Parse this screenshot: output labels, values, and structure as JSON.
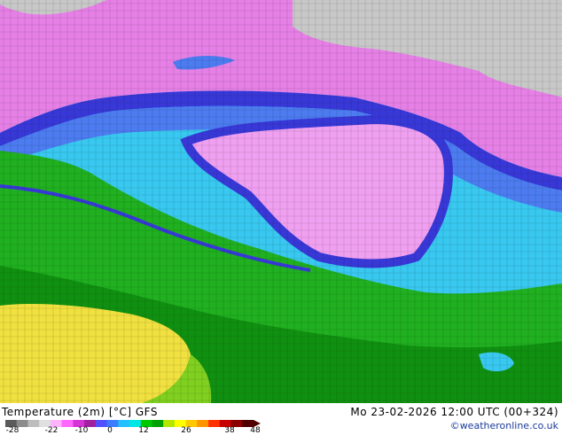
{
  "title": "Temperature (2m) [°C] GFS",
  "datetime": "Mo 23-02-2026 12:00 UTC (00+324)",
  "credit": "©weatheronline.co.uk",
  "legend": {
    "ticks": [
      "-28",
      "-22",
      "-10",
      "0",
      "12",
      "26",
      "38",
      "48"
    ],
    "colors": [
      "#5a5a5a",
      "#8c8c8c",
      "#bdbdbd",
      "#e0e0e0",
      "#ffb3ff",
      "#ff66ff",
      "#d633d6",
      "#a020a0",
      "#5050ff",
      "#3c7cff",
      "#22c0ff",
      "#00e6e6",
      "#00c800",
      "#00a000",
      "#b4e600",
      "#ffff00",
      "#ffc800",
      "#ff9600",
      "#ff3200",
      "#c80000",
      "#8c0000",
      "#500000"
    ]
  },
  "palette": {
    "snow": "#c8c8c8",
    "magenta": "#e680e6",
    "pink": "#f0a0f0",
    "deep_blue": "#3838d8",
    "blue": "#4c7cf0",
    "cyan": "#38c8f0",
    "green": "#20b020",
    "dark_green": "#109010",
    "yellow": "#f0e040",
    "light_green": "#80d020"
  }
}
